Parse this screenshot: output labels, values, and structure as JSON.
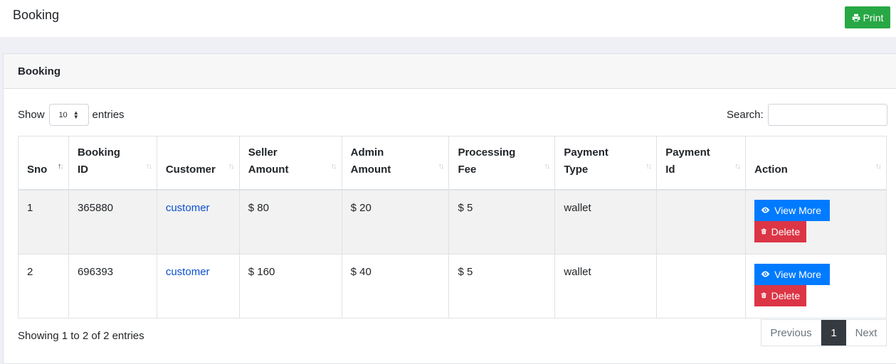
{
  "header": {
    "title": "Booking",
    "print_label": "Print"
  },
  "card": {
    "title": "Booking"
  },
  "length": {
    "show_label": "Show",
    "value": "10",
    "entries_label": "entries"
  },
  "search": {
    "label": "Search:",
    "value": ""
  },
  "table": {
    "columns": [
      {
        "line1": "Sno",
        "line2": ""
      },
      {
        "line1": "Booking",
        "line2": "ID"
      },
      {
        "line1": "Customer",
        "line2": ""
      },
      {
        "line1": "Seller",
        "line2": "Amount"
      },
      {
        "line1": "Admin",
        "line2": "Amount"
      },
      {
        "line1": "Processing",
        "line2": "Fee"
      },
      {
        "line1": "Payment",
        "line2": "Type"
      },
      {
        "line1": "Payment",
        "line2": "Id"
      },
      {
        "line1": "Action",
        "line2": ""
      }
    ],
    "rows": [
      {
        "sno": "1",
        "booking_id": "365880",
        "customer": "customer",
        "seller_amount": "$ 80",
        "admin_amount": "$ 20",
        "processing_fee": "$ 5",
        "payment_type": "wallet",
        "payment_id": ""
      },
      {
        "sno": "2",
        "booking_id": "696393",
        "customer": "customer",
        "seller_amount": "$ 160",
        "admin_amount": "$ 40",
        "processing_fee": "$ 5",
        "payment_type": "wallet",
        "payment_id": ""
      }
    ],
    "action_view_label": "View More",
    "action_delete_label": "Delete"
  },
  "footer": {
    "info": "Showing 1 to 2 of 2 entries"
  },
  "pagination": {
    "previous": "Previous",
    "current": "1",
    "next": "Next"
  },
  "colors": {
    "print": "#28a745",
    "view": "#007bff",
    "delete": "#dc3545",
    "page_active": "#343a40",
    "link": "#0b4fd1"
  },
  "icons": {
    "print": "printer-icon",
    "view": "eye-icon",
    "delete": "trash-icon",
    "sort": "sort-icon"
  }
}
